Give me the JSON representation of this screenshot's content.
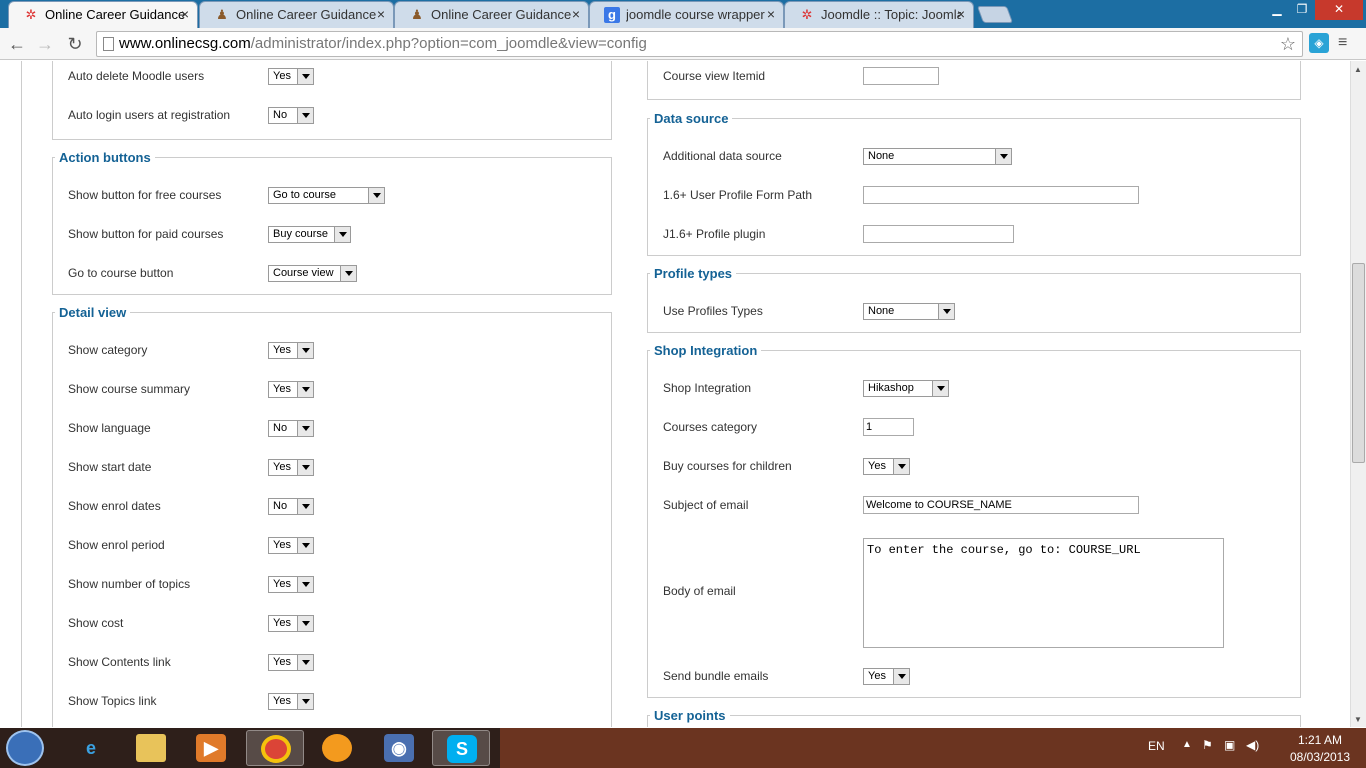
{
  "browser": {
    "tabs": [
      {
        "title": "Online Career Guidance A",
        "icon": "joomla-icon",
        "active": true
      },
      {
        "title": "Online Career Guidance A",
        "icon": "user-icon",
        "active": false
      },
      {
        "title": "Online Career Guidance A",
        "icon": "user-icon",
        "active": false
      },
      {
        "title": "joomdle course wrapper v",
        "icon": "google-icon",
        "active": false
      },
      {
        "title": "Joomdle :: Topic: Joomla c",
        "icon": "joomla-icon",
        "active": false
      }
    ],
    "url_domain": "www.onlinecsg.com",
    "url_path": "/administrator/index.php?option=com_joomdle&view=config"
  },
  "left": {
    "top_rows": [
      {
        "label": "Auto delete Moodle users",
        "value": "Yes"
      },
      {
        "label": "Auto login users at registration",
        "value": "No"
      }
    ],
    "action_buttons": {
      "legend": "Action buttons",
      "rows": [
        {
          "label": "Show button for free courses",
          "value": "Go to course"
        },
        {
          "label": "Show button for paid courses",
          "value": "Buy course"
        },
        {
          "label": "Go to course button",
          "value": "Course view"
        }
      ]
    },
    "detail_view": {
      "legend": "Detail view",
      "rows": [
        {
          "label": "Show category",
          "value": "Yes"
        },
        {
          "label": "Show course summary",
          "value": "Yes"
        },
        {
          "label": "Show language",
          "value": "No"
        },
        {
          "label": "Show start date",
          "value": "Yes"
        },
        {
          "label": "Show enrol dates",
          "value": "No"
        },
        {
          "label": "Show enrol period",
          "value": "Yes"
        },
        {
          "label": "Show number of topics",
          "value": "Yes"
        },
        {
          "label": "Show cost",
          "value": "Yes"
        },
        {
          "label": "Show Contents link",
          "value": "Yes"
        },
        {
          "label": "Show Topics link",
          "value": "Yes"
        }
      ]
    }
  },
  "right": {
    "course_view_itemid": {
      "label": "Course view Itemid",
      "value": ""
    },
    "data_source": {
      "legend": "Data source",
      "additional": {
        "label": "Additional data source",
        "value": "None"
      },
      "form_path": {
        "label": "1.6+ User Profile Form Path",
        "value": ""
      },
      "plugin": {
        "label": "J1.6+ Profile plugin",
        "value": ""
      }
    },
    "profile_types": {
      "legend": "Profile types",
      "use": {
        "label": "Use Profiles Types",
        "value": "None"
      }
    },
    "shop": {
      "legend": "Shop Integration",
      "shop_integration": {
        "label": "Shop Integration",
        "value": "Hikashop"
      },
      "courses_category": {
        "label": "Courses category",
        "value": "1"
      },
      "buy_children": {
        "label": "Buy courses for children",
        "value": "Yes"
      },
      "subject": {
        "label": "Subject of email",
        "value": "Welcome to COURSE_NAME"
      },
      "body": {
        "label": "Body of email",
        "value": "To enter the course, go to: COURSE_URL"
      },
      "bundle": {
        "label": "Send bundle emails",
        "value": "Yes"
      }
    },
    "user_points": {
      "legend": "User points"
    }
  },
  "taskbar": {
    "lang": "EN",
    "time": "1:21 AM",
    "date": "08/03/2013",
    "apps": [
      "ie-icon",
      "explorer-icon",
      "media-player-icon",
      "chrome-icon",
      "messenger-icon",
      "media-center-icon",
      "skype-icon"
    ]
  }
}
